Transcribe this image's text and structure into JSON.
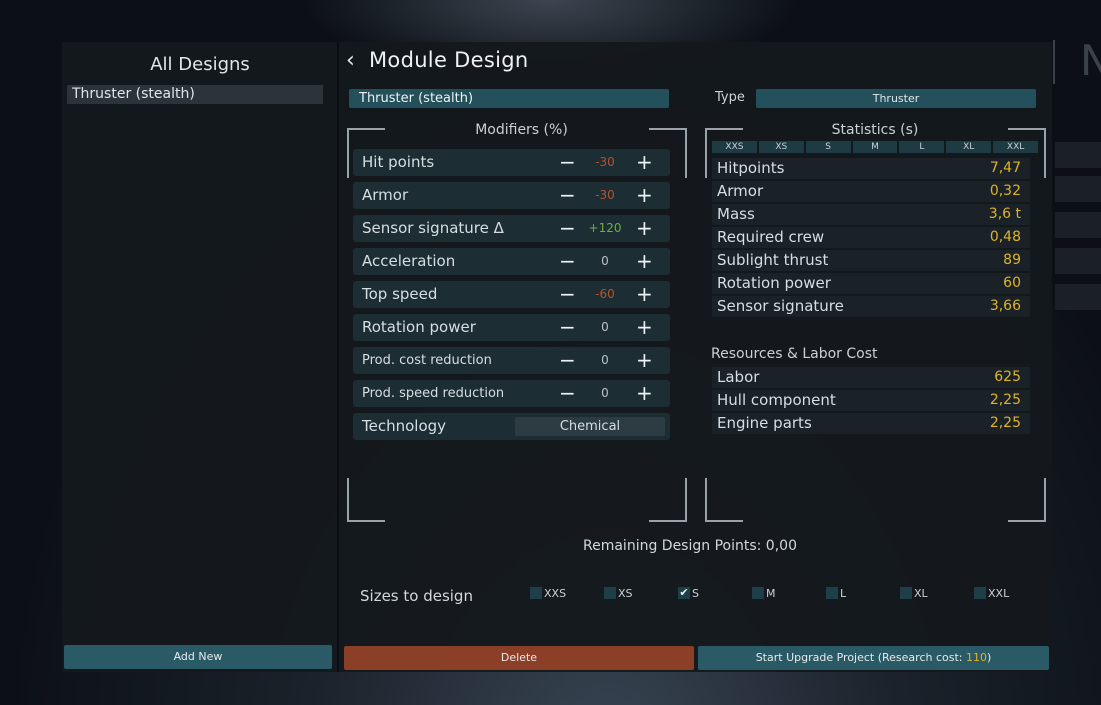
{
  "left": {
    "title": "All Designs",
    "designs": [
      "Thruster (stealth)"
    ],
    "add_new_label": "Add New"
  },
  "header": {
    "title": "Module Design",
    "back_icon": "chevron-left-icon",
    "name_value": "Thruster (stealth)",
    "type_label": "Type",
    "type_value": "Thruster"
  },
  "modifiers": {
    "title": "Modifiers (%)",
    "items": [
      {
        "label": "Hit points",
        "value": "-30",
        "color": "#b0552f"
      },
      {
        "label": "Armor",
        "value": "-30",
        "color": "#b0552f"
      },
      {
        "label": "Sensor signature Δ",
        "value": "+120",
        "color": "#6fae3a"
      },
      {
        "label": "Acceleration",
        "value": "0",
        "color": "#b9c2c8"
      },
      {
        "label": "Top speed",
        "value": "-60",
        "color": "#b0552f"
      },
      {
        "label": "Rotation power",
        "value": "0",
        "color": "#b9c2c8"
      },
      {
        "label": "Prod. cost reduction",
        "value": "0",
        "color": "#b9c2c8"
      },
      {
        "label": "Prod. speed reduction",
        "value": "0",
        "color": "#b9c2c8"
      }
    ],
    "technology_label": "Technology",
    "technology_value": "Chemical"
  },
  "statistics": {
    "title": "Statistics (s)",
    "size_tabs": [
      "XXS",
      "XS",
      "S",
      "M",
      "L",
      "XL",
      "XXL"
    ],
    "rows": [
      {
        "label": "Hitpoints",
        "value": "7,47"
      },
      {
        "label": "Armor",
        "value": "0,32"
      },
      {
        "label": "Mass",
        "value": "3,6 t"
      },
      {
        "label": "Required crew",
        "value": "0,48"
      },
      {
        "label": "Sublight thrust",
        "value": "89"
      },
      {
        "label": "Rotation power",
        "value": "60"
      },
      {
        "label": "Sensor signature",
        "value": "3,66"
      }
    ],
    "resources_title": "Resources & Labor Cost",
    "resources": [
      {
        "label": "Labor",
        "value": "625"
      },
      {
        "label": "Hull component",
        "value": "2,25"
      },
      {
        "label": "Engine parts",
        "value": "2,25"
      }
    ]
  },
  "remaining_points": "Remaining Design Points: 0,00",
  "sizes": {
    "label": "Sizes to design",
    "options": [
      {
        "label": "XXS",
        "checked": false
      },
      {
        "label": "XS",
        "checked": false
      },
      {
        "label": "S",
        "checked": true
      },
      {
        "label": "M",
        "checked": false
      },
      {
        "label": "L",
        "checked": false
      },
      {
        "label": "XL",
        "checked": false
      },
      {
        "label": "XXL",
        "checked": false
      }
    ]
  },
  "footer": {
    "delete_label": "Delete",
    "upgrade_label": "Start Upgrade Project (Research cost: ",
    "upgrade_cost": "110",
    "upgrade_suffix": ")"
  },
  "colors": {
    "accent_teal": "#2a5a66",
    "delete_red": "#8c3f27",
    "stat_value": "#e0b32a"
  }
}
